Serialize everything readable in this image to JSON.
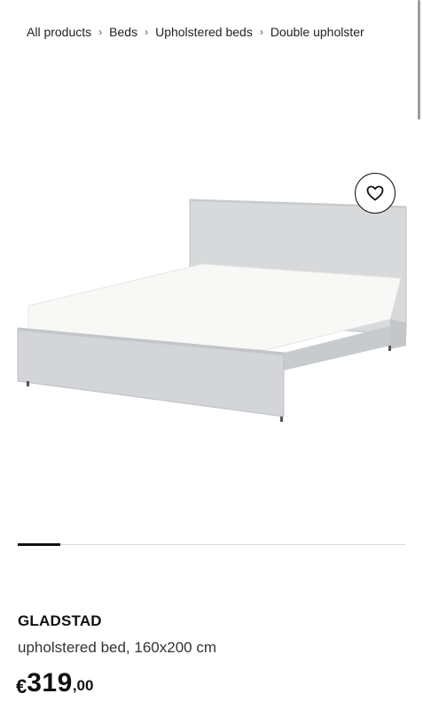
{
  "breadcrumb": {
    "items": [
      "All products",
      "Beds",
      "Upholstered beds",
      "Double upholster"
    ],
    "separator": "›"
  },
  "image": {
    "favourite_icon": "heart-icon",
    "carousel_progress": 0.11
  },
  "product": {
    "name": "GLADSTAD",
    "description": "upholstered bed, 160x200 cm",
    "price": {
      "currency": "€",
      "integer": "319",
      "decimals": ",00"
    }
  },
  "colors": {
    "text": "#111111",
    "bed_frame": "#d4d6d8",
    "mattress": "#f7f7f5"
  }
}
